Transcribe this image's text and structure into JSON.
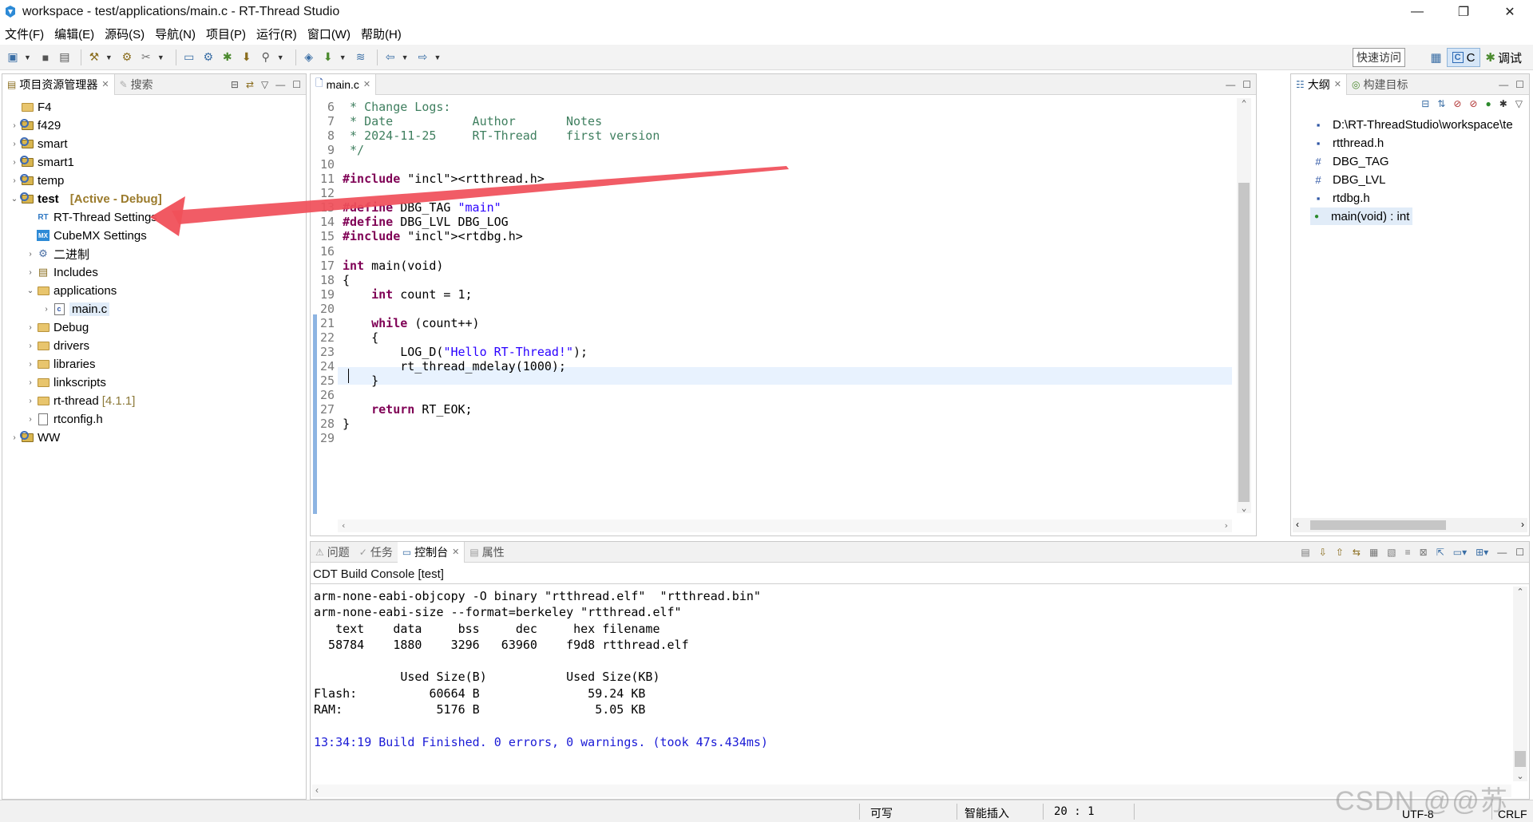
{
  "window": {
    "title": "workspace - test/applications/main.c - RT-Thread Studio",
    "minimize": "—",
    "restore": "❐",
    "close": "✕"
  },
  "menu": [
    "文件(F)",
    "编辑(E)",
    "源码(S)",
    "导航(N)",
    "项目(P)",
    "运行(R)",
    "窗口(W)",
    "帮助(H)"
  ],
  "toolbar": {
    "quick_access": "快速访问",
    "perspective_c": "C",
    "perspective_debug": "调试"
  },
  "explorer": {
    "tab_label": "项目资源管理器",
    "search_tab": "搜索",
    "items": [
      {
        "label": "F4",
        "tag": ""
      },
      {
        "label": "f429",
        "tag": ""
      },
      {
        "label": "smart",
        "tag": ""
      },
      {
        "label": "smart1",
        "tag": ""
      },
      {
        "label": "temp",
        "tag": ""
      },
      {
        "label": "test",
        "tag": "[Active - Debug]"
      },
      {
        "label": "RT-Thread Settings",
        "tag": ""
      },
      {
        "label": "CubeMX Settings",
        "tag": ""
      },
      {
        "label": "二进制",
        "tag": ""
      },
      {
        "label": "Includes",
        "tag": ""
      },
      {
        "label": "applications",
        "tag": ""
      },
      {
        "label": "main.c",
        "tag": ""
      },
      {
        "label": "Debug",
        "tag": ""
      },
      {
        "label": "drivers",
        "tag": ""
      },
      {
        "label": "libraries",
        "tag": ""
      },
      {
        "label": "linkscripts",
        "tag": ""
      },
      {
        "label": "rt-thread",
        "tag": "[4.1.1]"
      },
      {
        "label": "rtconfig.h",
        "tag": ""
      },
      {
        "label": "WW",
        "tag": ""
      }
    ]
  },
  "editor": {
    "tab_label": "main.c",
    "lines": [
      {
        "n": "6",
        "t": " * Change Logs:"
      },
      {
        "n": "7",
        "t": " * Date           Author       Notes"
      },
      {
        "n": "8",
        "t": " * 2024-11-25     RT-Thread    first version"
      },
      {
        "n": "9",
        "t": " */"
      },
      {
        "n": "10",
        "t": ""
      },
      {
        "n": "11",
        "t": "#include <rtthread.h>"
      },
      {
        "n": "12",
        "t": ""
      },
      {
        "n": "13",
        "t": "#define DBG_TAG \"main\""
      },
      {
        "n": "14",
        "t": "#define DBG_LVL DBG_LOG"
      },
      {
        "n": "15",
        "t": "#include <rtdbg.h>"
      },
      {
        "n": "16",
        "t": ""
      },
      {
        "n": "17",
        "t": "int main(void)"
      },
      {
        "n": "18",
        "t": "{"
      },
      {
        "n": "19",
        "t": "    int count = 1;"
      },
      {
        "n": "20",
        "t": ""
      },
      {
        "n": "21",
        "t": "    while (count++)"
      },
      {
        "n": "22",
        "t": "    {"
      },
      {
        "n": "23",
        "t": "        LOG_D(\"Hello RT-Thread!\");"
      },
      {
        "n": "24",
        "t": "        rt_thread_mdelay(1000);"
      },
      {
        "n": "25",
        "t": "    }"
      },
      {
        "n": "26",
        "t": ""
      },
      {
        "n": "27",
        "t": "    return RT_EOK;"
      },
      {
        "n": "28",
        "t": "}"
      },
      {
        "n": "29",
        "t": ""
      }
    ]
  },
  "outline": {
    "tab_label": "大纲",
    "build_tab": "构建目标",
    "items": [
      {
        "label": "D:\\RT-ThreadStudio\\workspace\\te",
        "icon": "include-icon"
      },
      {
        "label": "rtthread.h",
        "icon": "include-icon"
      },
      {
        "label": "DBG_TAG",
        "icon": "macro-icon"
      },
      {
        "label": "DBG_LVL",
        "icon": "macro-icon"
      },
      {
        "label": "rtdbg.h",
        "icon": "include-icon"
      },
      {
        "label": "main(void) : int",
        "icon": "function-icon"
      }
    ]
  },
  "console": {
    "tabs": [
      "问题",
      "任务",
      "控制台",
      "属性"
    ],
    "header": "CDT Build Console [test]",
    "lines": [
      "arm-none-eabi-objcopy -O binary \"rtthread.elf\"  \"rtthread.bin\"",
      "arm-none-eabi-size --format=berkeley \"rtthread.elf\"",
      "   text    data     bss     dec     hex filename",
      "  58784    1880    3296   63960    f9d8 rtthread.elf",
      "",
      "            Used Size(B)           Used Size(KB)",
      "Flash:          60664 B               59.24 KB",
      "RAM:             5176 B                5.05 KB",
      ""
    ],
    "finish": "13:34:19 Build Finished. 0 errors, 0 warnings. (took 47s.434ms)"
  },
  "status": {
    "writable": "可写",
    "insert": "智能插入",
    "position": "20 : 1",
    "encoding": "UTF-8",
    "eol": "CRLF"
  },
  "watermark": "CSDN @@苏瑾"
}
